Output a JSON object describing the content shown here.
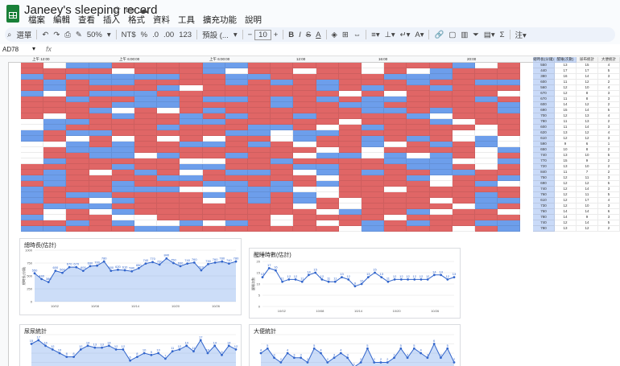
{
  "app": {
    "title": "Janeey's sleeping record",
    "menu": [
      "檔案",
      "編輯",
      "查看",
      "插入",
      "格式",
      "資料",
      "工具",
      "擴充功能",
      "說明"
    ]
  },
  "toolbar": {
    "search": "選單",
    "zoom": "50%",
    "currency": "NT$",
    "percent": "%",
    "dec1": ".0",
    "dec2": ".00",
    "num": "123",
    "font": "預設 (...",
    "size": "10"
  },
  "formula_bar": {
    "cell": "AD78",
    "fx": "fx",
    "value": ""
  },
  "sheet": {
    "header_times": [
      "上午 12:00",
      "上午 6:00:00",
      "上午 6:00:00",
      "12:00",
      "16:00",
      "20:00"
    ],
    "summary_headers": [
      "總時長(分鐘)",
      "醒睡(次數)",
      "尿布統計",
      "大便統計"
    ],
    "summary_rows": [
      [
        "550",
        "13",
        "15",
        "4"
      ],
      [
        "440",
        "17",
        "17",
        "5"
      ],
      [
        "380",
        "16",
        "14",
        "3"
      ],
      [
        "600",
        "11",
        "12",
        "2"
      ],
      [
        "560",
        "12",
        "10",
        "4"
      ],
      [
        "670",
        "12",
        "8",
        "3"
      ],
      [
        "670",
        "11",
        "8",
        "3"
      ],
      [
        "600",
        "14",
        "12",
        "2"
      ],
      [
        "690",
        "15",
        "14",
        "5"
      ],
      [
        "700",
        "12",
        "13",
        "4"
      ],
      [
        "780",
        "11",
        "13",
        "2"
      ],
      [
        "600",
        "11",
        "14",
        "3"
      ],
      [
        "620",
        "13",
        "12",
        "4"
      ],
      [
        "610",
        "12",
        "12",
        "3"
      ],
      [
        "590",
        "9",
        "6",
        "1"
      ],
      [
        "650",
        "10",
        "8",
        "2"
      ],
      [
        "740",
        "13",
        "10",
        "5"
      ],
      [
        "770",
        "15",
        "9",
        "2"
      ],
      [
        "720",
        "13",
        "10",
        "2"
      ],
      [
        "840",
        "11",
        "7",
        "2"
      ],
      [
        "750",
        "12",
        "11",
        "3"
      ],
      [
        "690",
        "12",
        "12",
        "5"
      ],
      [
        "740",
        "12",
        "14",
        "3"
      ],
      [
        "760",
        "12",
        "11",
        "5"
      ],
      [
        "610",
        "12",
        "17",
        "4"
      ],
      [
        "730",
        "12",
        "10",
        "3"
      ],
      [
        "760",
        "14",
        "14",
        "6"
      ],
      [
        "780",
        "14",
        "9",
        "3"
      ],
      [
        "740",
        "12",
        "14",
        "5"
      ],
      [
        "780",
        "13",
        "12",
        "2"
      ]
    ]
  },
  "charts": [
    {
      "title": "總時長(估計)",
      "chart_data": {
        "type": "line",
        "title": "總時長(估計)",
        "xlabel": "",
        "ylabel": "總時長(分鐘)",
        "ylim": [
          0,
          1000
        ],
        "x_ticks": [
          "10/02",
          "10/08",
          "10/14",
          "10/20",
          "10/26"
        ],
        "y_ticks": [
          "0",
          "250",
          "500",
          "750",
          "1000"
        ],
        "series": [
          {
            "values": [
              550,
              440,
              380,
              600,
              560,
              670,
              670,
              600,
              690,
              700,
              780,
              600,
              620,
              610,
              590,
              650,
              740,
              770,
              720,
              840,
              750,
              690,
              740,
              760,
              610,
              730,
              760,
              780,
              740,
              780
            ]
          }
        ]
      }
    },
    {
      "title": "醒睡時數(估計)",
      "chart_data": {
        "type": "line",
        "title": "醒睡時數(估計)",
        "xlabel": "",
        "ylabel": "醒睡次數",
        "ylim": [
          0,
          20
        ],
        "x_ticks": [
          "10/02",
          "10/08",
          "10/14",
          "10/20",
          "10/26"
        ],
        "y_ticks": [
          "0",
          "5",
          "10",
          "15",
          "20"
        ],
        "series": [
          {
            "values": [
              13,
              17,
              16,
              11,
              12,
              12,
              11,
              14,
              15,
              12,
              11,
              11,
              13,
              12,
              9,
              10,
              13,
              15,
              13,
              11,
              12,
              12,
              12,
              12,
              12,
              12,
              14,
              14,
              12,
              13
            ]
          }
        ]
      }
    },
    {
      "title": "尿尿統計",
      "chart_data": {
        "type": "area",
        "title": "尿尿統計",
        "ylim": [
          0,
          20
        ],
        "series": [
          {
            "values": [
              15,
              17,
              14,
              12,
              10,
              8,
              8,
              12,
              14,
              13,
              13,
              14,
              12,
              12,
              6,
              8,
              10,
              9,
              10,
              7,
              11,
              12,
              14,
              11,
              17,
              10,
              14,
              9,
              14,
              12
            ]
          }
        ]
      }
    },
    {
      "title": "大便統計",
      "chart_data": {
        "type": "area",
        "title": "大便統計",
        "ylim": [
          0,
          8
        ],
        "series": [
          {
            "values": [
              4,
              5,
              3,
              2,
              4,
              3,
              3,
              2,
              5,
              4,
              2,
              3,
              4,
              3,
              1,
              2,
              5,
              2,
              2,
              2,
              3,
              5,
              3,
              5,
              4,
              3,
              6,
              3,
              5,
              2
            ]
          }
        ]
      }
    }
  ]
}
